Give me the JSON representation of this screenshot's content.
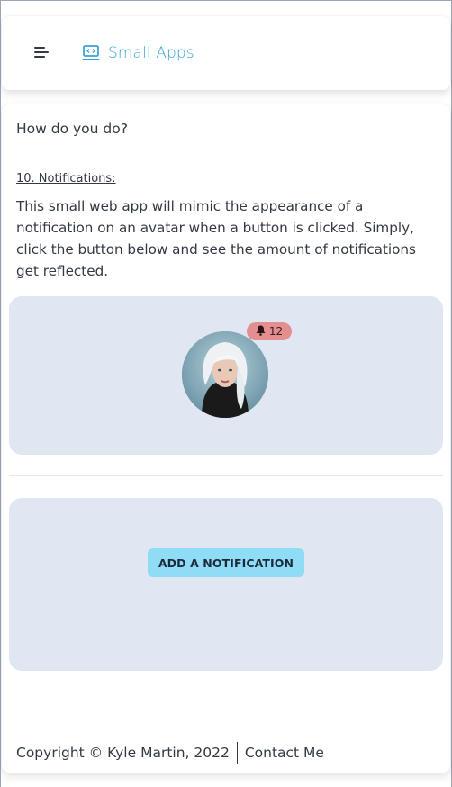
{
  "header": {
    "brand_name": "Small Apps",
    "brand_color": "#3aa3d6",
    "menu_icon": "hamburger-icon",
    "brand_icon": "laptop-code-icon"
  },
  "main": {
    "greeting": "How do you do?",
    "section_title": "10. Notifications:",
    "description": "This small web app will mimic the appearance of a notification on an avatar when a button is clicked. Simply, click the button below and see the amount of notifications get reflected.",
    "notification_count": "12",
    "badge_icon": "bell-icon",
    "badge_color": "#e38f8f",
    "button_label": "ADD A NOTIFICATION",
    "button_color": "#8fdcf6",
    "panel_color": "#e1e7f2"
  },
  "footer": {
    "copyright": "Copyright © Kyle Martin, 2022",
    "contact": "Contact Me"
  }
}
